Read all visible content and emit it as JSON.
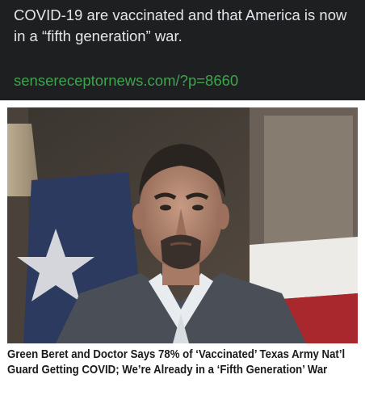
{
  "post": {
    "text": "COVID-19 are vaccinated and that America is now in a “fifth generation” war.",
    "link": "sensereceptornews.com/?p=8660"
  },
  "preview": {
    "title": "Green Beret and Doctor Says 78% of ‘Vaccinated’ Texas Army Nat’l Guard Getting COVID; We’re Already in a ‘Fifth Generation’ War",
    "image_description_icon": "person-photo"
  },
  "colors": {
    "post_background": "#1e1f21",
    "post_text": "#e4e6eb",
    "link": "#3fa34d",
    "title_text": "#1a1a1a"
  }
}
